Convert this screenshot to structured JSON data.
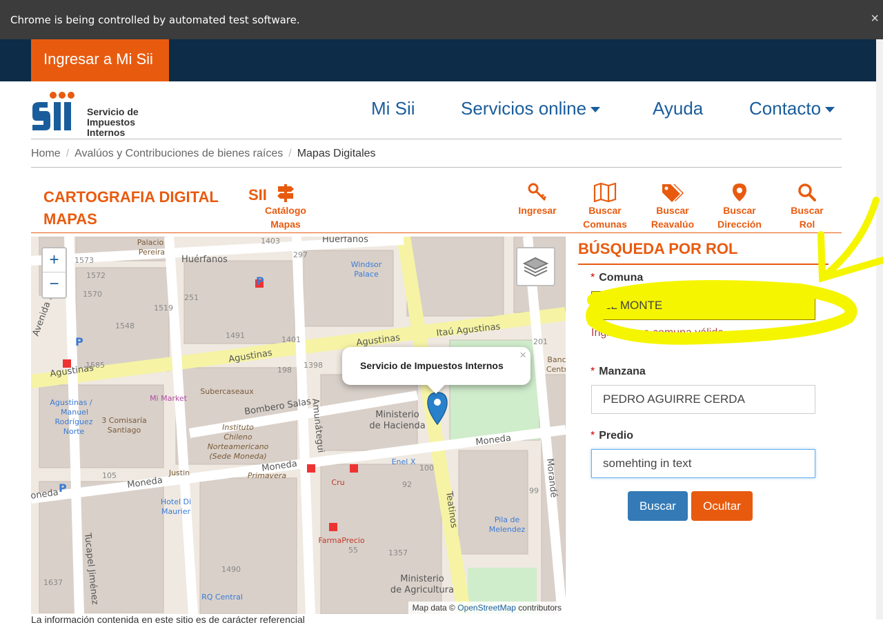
{
  "infobar": {
    "message": "Chrome is being controlled by automated test software.",
    "close": "×"
  },
  "topbar": {
    "login_label": "Ingresar a Mi Sii"
  },
  "logo": {
    "line1": "Servicio de",
    "line2": "Impuestos",
    "line3": "Internos"
  },
  "nav": {
    "mi_sii": "Mi Sii",
    "servicios": "Servicios online",
    "ayuda": "Ayuda",
    "contacto": "Contacto"
  },
  "breadcrumb": {
    "home": "Home",
    "avaluos": "Avalúos y Contribuciones de bienes raíces",
    "current": "Mapas Digitales"
  },
  "toolbar": {
    "title_line1": "CARTOGRAFIA DIGITAL",
    "title_line2": "MAPAS",
    "sii": "SII",
    "catalogo_l1": "Catálogo",
    "catalogo_l2": "Mapas",
    "ingresar": "Ingresar",
    "comunas_l1": "Buscar",
    "comunas_l2": "Comunas",
    "reavaluo_l1": "Buscar",
    "reavaluo_l2": "Reavalúo",
    "direccion_l1": "Buscar",
    "direccion_l2": "Dirección",
    "rol_l1": "Buscar",
    "rol_l2": "Rol"
  },
  "map": {
    "zoom_in": "+",
    "zoom_out": "−",
    "popup_text": "Servicio de Impuestos Internos",
    "popup_close": "×",
    "attrib_prefix": "Map data ©",
    "attrib_link": "OpenStreetMap",
    "attrib_suffix": "contributors",
    "labels": {
      "huerfanos": "Huérfanos",
      "huerfanos2": "Huérfanos",
      "agustinas": "Agustinas",
      "agustinas2": "Agustinas",
      "agustinas3": "Agustinas",
      "agustinas4": "Itaú Agustinas",
      "moneda": "Moneda",
      "moneda2": "Moneda",
      "moneda3": "Moneda",
      "moneda4": "oneda",
      "bombero": "Bombero Salas",
      "teatinos": "Teatinos",
      "amunategui": "Amunátegui",
      "morande": "Morandé",
      "tucapel": "Tucapel Jiménez",
      "avenida": "Avenida Ma",
      "windsor1": "Windsor",
      "windsor2": "Palace",
      "palacio1": "Palacio",
      "palacio2": "Pereira",
      "minhac1": "Ministerio",
      "minhac2": "de Hacienda",
      "minagr1": "Ministerio",
      "minagr2": "de Agricultura",
      "instituto1": "Instituto",
      "instituto2": "Chileno",
      "instituto3": "Norteamericano",
      "instituto4": "(Sede Moneda)",
      "comisaria1": "3 Comisaría",
      "comisaria2": "Santiago",
      "mimarket": "Mi Market",
      "subercaseaux": "Subercaseaux",
      "agnorte1": "Agustinas /",
      "agnorte2": "Manuel",
      "agnorte3": "Rodríguez",
      "agnorte4": "Norte",
      "hotel1": "Hotel Di",
      "hotel2": "Maurier",
      "farmaprecio": "FarmaPrecio",
      "pila1": "Pila de",
      "pila2": "Melendez",
      "banco1": "Banc",
      "banco2": "Centr",
      "primavera": "Primavera",
      "enelx": "Enel X",
      "qcentral": "RQ Central",
      "justin": "Justin",
      "cru": "Cru",
      "n1573": "1573",
      "n1572": "1572",
      "n1570": "1570",
      "n1548": "1548",
      "n1519": "1519",
      "n1585": "1585",
      "n1491": "1491",
      "n1401": "1401",
      "n1403": "1403",
      "n297": "297",
      "n251": "251",
      "n198": "198",
      "n1398": "1398",
      "n100": "100",
      "n92": "92",
      "n55": "55",
      "n1357": "1357",
      "n1490": "1490",
      "n1637": "1637",
      "n99": "99",
      "n201": "201",
      "n105": "105"
    }
  },
  "search": {
    "title": "BÚSQUEDA POR ROL",
    "comuna_label": "Comuna",
    "comuna_value": "EL MONTE",
    "comuna_hint": "Ingrese una comuna válida",
    "manzana_label": "Manzana",
    "manzana_value": "PEDRO AGUIRRE CERDA",
    "predio_label": "Predio",
    "predio_value": "somehting in text",
    "required_mark": "*",
    "buscar_label": "Buscar",
    "ocultar_label": "Ocultar"
  },
  "footer": {
    "text": "La información contenida en este sitio es de carácter referencial"
  },
  "colors": {
    "brand_orange": "#e85b0f",
    "brand_blue": "#1a5d9c",
    "navy": "#0c2c47",
    "highlight": "#f5f500"
  }
}
